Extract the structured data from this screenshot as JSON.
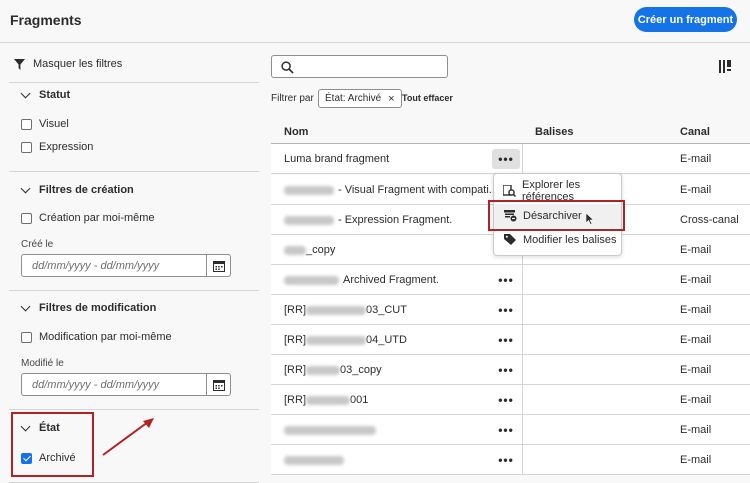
{
  "header": {
    "title": "Fragments",
    "create_label": "Créer un fragment"
  },
  "sidebar": {
    "hide_filters": "Masquer les filtres",
    "status": {
      "title": "Statut",
      "options": [
        "Visuel",
        "Expression"
      ]
    },
    "creation": {
      "title": "Filtres de création",
      "mine": "Création par moi-même",
      "date_label": "Créé le",
      "date_placeholder": "dd/mm/yyyy  -  dd/mm/yyyy"
    },
    "modification": {
      "title": "Filtres de modification",
      "mine": "Modification par moi-même",
      "date_label": "Modifié le",
      "date_placeholder": "dd/mm/yyyy  -  dd/mm/yyyy"
    },
    "state": {
      "title": "État",
      "option": "Archivé",
      "checked": true
    }
  },
  "filters": {
    "label": "Filtrer par",
    "tag": "État: Archivé",
    "clear": "Tout effacer"
  },
  "table": {
    "columns": [
      "Nom",
      "Balises",
      "Canal"
    ],
    "rows": [
      {
        "name": "Luma brand fragment",
        "canal": "E-mail"
      },
      {
        "name": "- Visual Fragment with compati...",
        "canal": "E-mail"
      },
      {
        "name": "- Expression Fragment.",
        "canal": "Cross-canal"
      },
      {
        "name": "_copy",
        "canal": "E-mail"
      },
      {
        "name": "Archived Fragment.",
        "canal": "E-mail"
      },
      {
        "name": "[RR]",
        "suffix": "03_CUT",
        "canal": "E-mail"
      },
      {
        "name": "[RR]",
        "suffix": "04_UTD",
        "canal": "E-mail"
      },
      {
        "name": "[RR]",
        "suffix": "03_copy",
        "canal": "E-mail"
      },
      {
        "name": "[RR]",
        "suffix": "001",
        "canal": "E-mail"
      },
      {
        "name": "",
        "canal": "E-mail"
      },
      {
        "name": "",
        "canal": "E-mail"
      }
    ]
  },
  "context_menu": {
    "items": [
      "Explorer les références",
      "Désarchiver",
      "Modifier les balises"
    ]
  },
  "colors": {
    "accent": "#1473e6",
    "highlight": "#b22222"
  }
}
